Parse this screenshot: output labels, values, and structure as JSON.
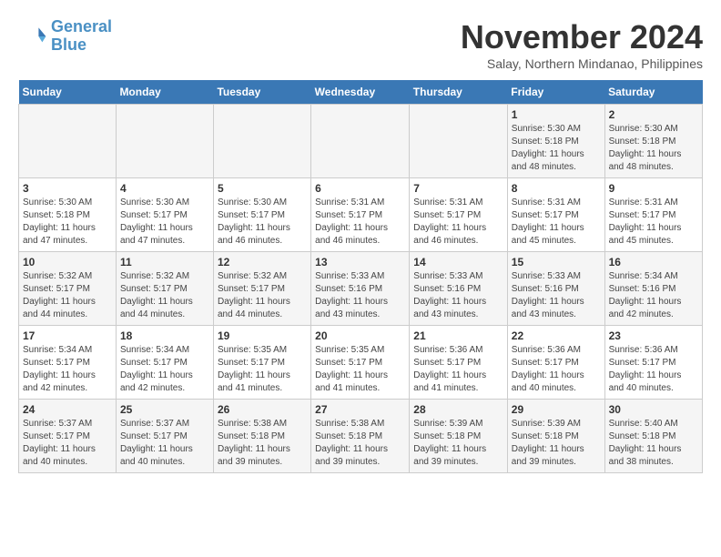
{
  "logo": {
    "line1": "General",
    "line2": "Blue"
  },
  "title": "November 2024",
  "location": "Salay, Northern Mindanao, Philippines",
  "weekdays": [
    "Sunday",
    "Monday",
    "Tuesday",
    "Wednesday",
    "Thursday",
    "Friday",
    "Saturday"
  ],
  "weeks": [
    [
      {
        "day": "",
        "sunrise": "",
        "sunset": "",
        "daylight": ""
      },
      {
        "day": "",
        "sunrise": "",
        "sunset": "",
        "daylight": ""
      },
      {
        "day": "",
        "sunrise": "",
        "sunset": "",
        "daylight": ""
      },
      {
        "day": "",
        "sunrise": "",
        "sunset": "",
        "daylight": ""
      },
      {
        "day": "",
        "sunrise": "",
        "sunset": "",
        "daylight": ""
      },
      {
        "day": "1",
        "sunrise": "Sunrise: 5:30 AM",
        "sunset": "Sunset: 5:18 PM",
        "daylight": "Daylight: 11 hours and 48 minutes."
      },
      {
        "day": "2",
        "sunrise": "Sunrise: 5:30 AM",
        "sunset": "Sunset: 5:18 PM",
        "daylight": "Daylight: 11 hours and 48 minutes."
      }
    ],
    [
      {
        "day": "3",
        "sunrise": "Sunrise: 5:30 AM",
        "sunset": "Sunset: 5:18 PM",
        "daylight": "Daylight: 11 hours and 47 minutes."
      },
      {
        "day": "4",
        "sunrise": "Sunrise: 5:30 AM",
        "sunset": "Sunset: 5:17 PM",
        "daylight": "Daylight: 11 hours and 47 minutes."
      },
      {
        "day": "5",
        "sunrise": "Sunrise: 5:30 AM",
        "sunset": "Sunset: 5:17 PM",
        "daylight": "Daylight: 11 hours and 46 minutes."
      },
      {
        "day": "6",
        "sunrise": "Sunrise: 5:31 AM",
        "sunset": "Sunset: 5:17 PM",
        "daylight": "Daylight: 11 hours and 46 minutes."
      },
      {
        "day": "7",
        "sunrise": "Sunrise: 5:31 AM",
        "sunset": "Sunset: 5:17 PM",
        "daylight": "Daylight: 11 hours and 46 minutes."
      },
      {
        "day": "8",
        "sunrise": "Sunrise: 5:31 AM",
        "sunset": "Sunset: 5:17 PM",
        "daylight": "Daylight: 11 hours and 45 minutes."
      },
      {
        "day": "9",
        "sunrise": "Sunrise: 5:31 AM",
        "sunset": "Sunset: 5:17 PM",
        "daylight": "Daylight: 11 hours and 45 minutes."
      }
    ],
    [
      {
        "day": "10",
        "sunrise": "Sunrise: 5:32 AM",
        "sunset": "Sunset: 5:17 PM",
        "daylight": "Daylight: 11 hours and 44 minutes."
      },
      {
        "day": "11",
        "sunrise": "Sunrise: 5:32 AM",
        "sunset": "Sunset: 5:17 PM",
        "daylight": "Daylight: 11 hours and 44 minutes."
      },
      {
        "day": "12",
        "sunrise": "Sunrise: 5:32 AM",
        "sunset": "Sunset: 5:17 PM",
        "daylight": "Daylight: 11 hours and 44 minutes."
      },
      {
        "day": "13",
        "sunrise": "Sunrise: 5:33 AM",
        "sunset": "Sunset: 5:16 PM",
        "daylight": "Daylight: 11 hours and 43 minutes."
      },
      {
        "day": "14",
        "sunrise": "Sunrise: 5:33 AM",
        "sunset": "Sunset: 5:16 PM",
        "daylight": "Daylight: 11 hours and 43 minutes."
      },
      {
        "day": "15",
        "sunrise": "Sunrise: 5:33 AM",
        "sunset": "Sunset: 5:16 PM",
        "daylight": "Daylight: 11 hours and 43 minutes."
      },
      {
        "day": "16",
        "sunrise": "Sunrise: 5:34 AM",
        "sunset": "Sunset: 5:16 PM",
        "daylight": "Daylight: 11 hours and 42 minutes."
      }
    ],
    [
      {
        "day": "17",
        "sunrise": "Sunrise: 5:34 AM",
        "sunset": "Sunset: 5:17 PM",
        "daylight": "Daylight: 11 hours and 42 minutes."
      },
      {
        "day": "18",
        "sunrise": "Sunrise: 5:34 AM",
        "sunset": "Sunset: 5:17 PM",
        "daylight": "Daylight: 11 hours and 42 minutes."
      },
      {
        "day": "19",
        "sunrise": "Sunrise: 5:35 AM",
        "sunset": "Sunset: 5:17 PM",
        "daylight": "Daylight: 11 hours and 41 minutes."
      },
      {
        "day": "20",
        "sunrise": "Sunrise: 5:35 AM",
        "sunset": "Sunset: 5:17 PM",
        "daylight": "Daylight: 11 hours and 41 minutes."
      },
      {
        "day": "21",
        "sunrise": "Sunrise: 5:36 AM",
        "sunset": "Sunset: 5:17 PM",
        "daylight": "Daylight: 11 hours and 41 minutes."
      },
      {
        "day": "22",
        "sunrise": "Sunrise: 5:36 AM",
        "sunset": "Sunset: 5:17 PM",
        "daylight": "Daylight: 11 hours and 40 minutes."
      },
      {
        "day": "23",
        "sunrise": "Sunrise: 5:36 AM",
        "sunset": "Sunset: 5:17 PM",
        "daylight": "Daylight: 11 hours and 40 minutes."
      }
    ],
    [
      {
        "day": "24",
        "sunrise": "Sunrise: 5:37 AM",
        "sunset": "Sunset: 5:17 PM",
        "daylight": "Daylight: 11 hours and 40 minutes."
      },
      {
        "day": "25",
        "sunrise": "Sunrise: 5:37 AM",
        "sunset": "Sunset: 5:17 PM",
        "daylight": "Daylight: 11 hours and 40 minutes."
      },
      {
        "day": "26",
        "sunrise": "Sunrise: 5:38 AM",
        "sunset": "Sunset: 5:18 PM",
        "daylight": "Daylight: 11 hours and 39 minutes."
      },
      {
        "day": "27",
        "sunrise": "Sunrise: 5:38 AM",
        "sunset": "Sunset: 5:18 PM",
        "daylight": "Daylight: 11 hours and 39 minutes."
      },
      {
        "day": "28",
        "sunrise": "Sunrise: 5:39 AM",
        "sunset": "Sunset: 5:18 PM",
        "daylight": "Daylight: 11 hours and 39 minutes."
      },
      {
        "day": "29",
        "sunrise": "Sunrise: 5:39 AM",
        "sunset": "Sunset: 5:18 PM",
        "daylight": "Daylight: 11 hours and 39 minutes."
      },
      {
        "day": "30",
        "sunrise": "Sunrise: 5:40 AM",
        "sunset": "Sunset: 5:18 PM",
        "daylight": "Daylight: 11 hours and 38 minutes."
      }
    ]
  ]
}
